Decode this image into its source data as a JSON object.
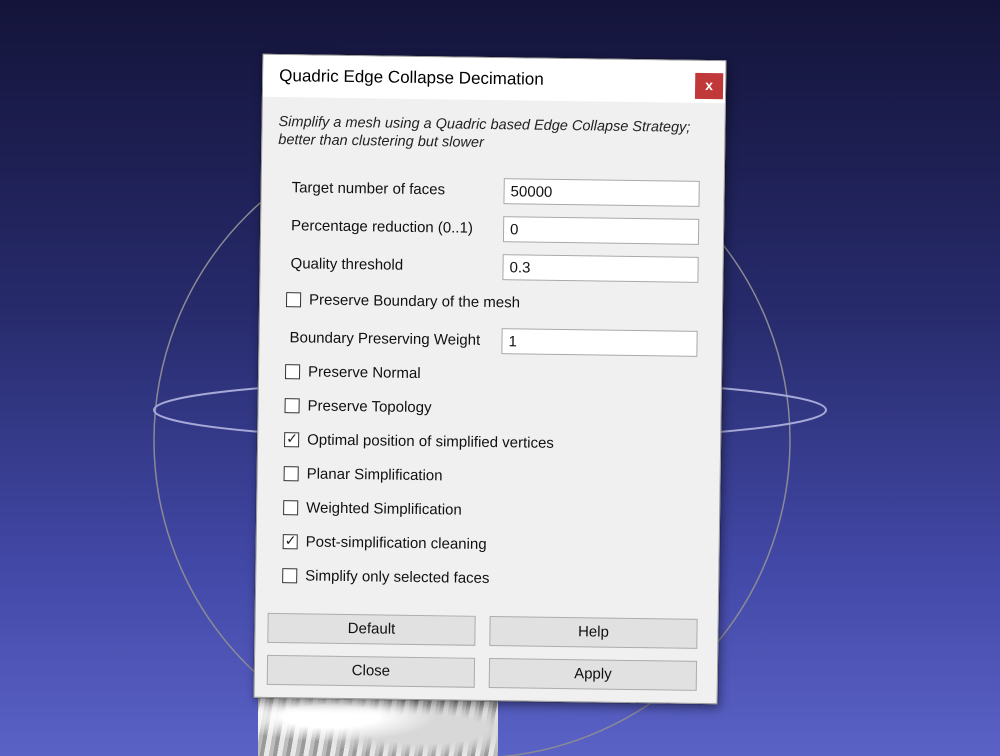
{
  "dialog": {
    "title": "Quadric Edge Collapse Decimation",
    "close_glyph": "x",
    "description": "Simplify a mesh using a Quadric based Edge Collapse Strategy; better than clustering but slower"
  },
  "fields": {
    "target_faces": {
      "label": "Target number of faces",
      "value": "50000"
    },
    "percentage_reduction": {
      "label": "Percentage reduction (0..1)",
      "value": "0"
    },
    "quality_threshold": {
      "label": "Quality threshold",
      "value": "0.3"
    },
    "boundary_weight": {
      "label": "Boundary Preserving Weight",
      "value": "1"
    }
  },
  "checkboxes": {
    "preserve_boundary": {
      "label": "Preserve Boundary of the mesh",
      "checked": false
    },
    "preserve_normal": {
      "label": "Preserve Normal",
      "checked": false
    },
    "preserve_topology": {
      "label": "Preserve Topology",
      "checked": false
    },
    "optimal_position": {
      "label": "Optimal position of simplified vertices",
      "checked": true
    },
    "planar_simplification": {
      "label": "Planar Simplification",
      "checked": false
    },
    "weighted_simplification": {
      "label": "Weighted Simplification",
      "checked": false
    },
    "post_cleaning": {
      "label": "Post-simplification cleaning",
      "checked": true
    },
    "selected_faces_only": {
      "label": "Simplify only selected faces",
      "checked": false
    }
  },
  "check_glyph": "✓",
  "buttons": {
    "default": "Default",
    "help": "Help",
    "close": "Close",
    "apply": "Apply"
  },
  "colors": {
    "close_button": "#c0383a",
    "dialog_bg": "#f0f0f0",
    "viewport_top": "#14143a",
    "viewport_bottom": "#5a62c6"
  }
}
